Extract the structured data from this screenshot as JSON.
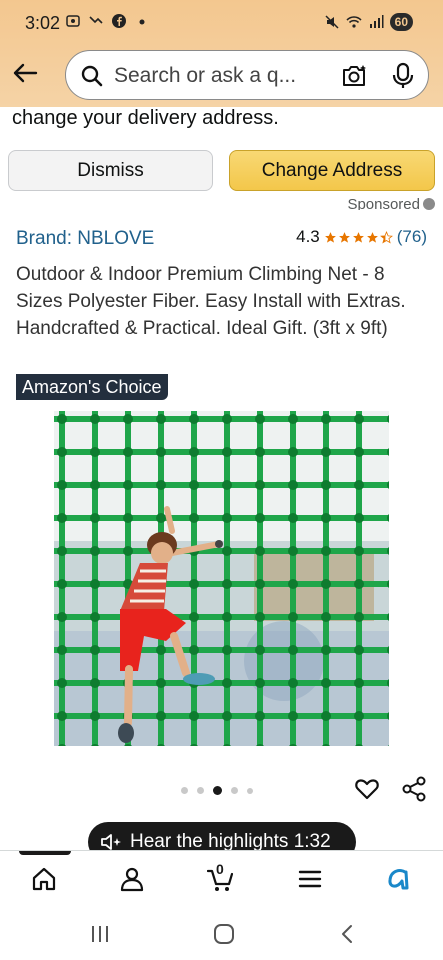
{
  "status_bar": {
    "time": "3:02",
    "battery": "60"
  },
  "search": {
    "placeholder": "Search or ask a q..."
  },
  "delivery_notice": {
    "text": "change your delivery address."
  },
  "buttons": {
    "dismiss": "Dismiss",
    "change_address": "Change Address"
  },
  "sponsored": {
    "label": "Sponsored"
  },
  "product": {
    "brand": "Brand: NBLOVE",
    "rating": "4.3",
    "stars": 4.3,
    "review_count": "(76)",
    "title": "Outdoor & Indoor Premium Climbing Net - 8 Sizes Polyester Fiber. Easy Install with Extras. Handcrafted & Practical. Ideal Gift. (3ft x 9ft)",
    "badge": "Amazon's Choice"
  },
  "carousel": {
    "total": 5,
    "active_index": 2
  },
  "highlights": {
    "label": "Hear the highlights 1:32"
  },
  "bottom_nav": {
    "cart_count": "0",
    "items": [
      "home-icon",
      "account-icon",
      "cart-icon",
      "menu-icon",
      "rufus-icon"
    ]
  },
  "colors": {
    "header_bg": "#f3c78f",
    "link": "#21618c",
    "star": "#e77600",
    "badge_bg": "#232f3e",
    "change_button": "#f3c74a",
    "net_green": "#1fa64a"
  }
}
